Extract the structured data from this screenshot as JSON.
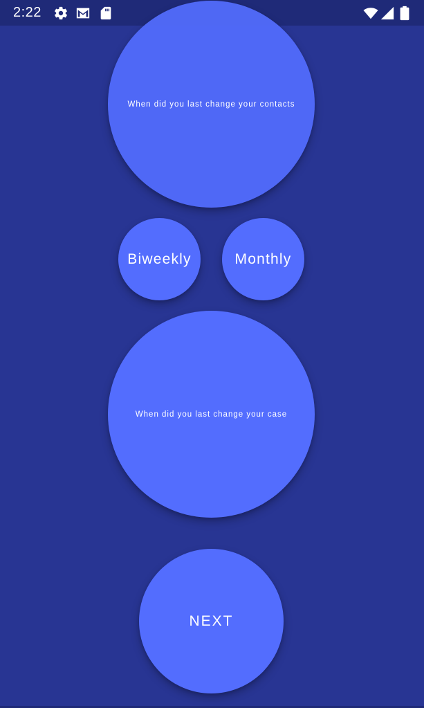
{
  "status_bar": {
    "time": "2:22",
    "left_icons": [
      "settings-icon",
      "gmail-icon",
      "sd-card-icon"
    ],
    "right_icons": [
      "wifi-icon",
      "signal-icon",
      "battery-icon"
    ]
  },
  "questions": [
    {
      "text": "When did you last change your contacts"
    },
    {
      "text": "When did you last change your case"
    }
  ],
  "options": [
    {
      "label": "Biweekly"
    },
    {
      "label": "Monthly"
    }
  ],
  "next_button": {
    "label": "NEXT"
  },
  "colors": {
    "background": "#283593",
    "status_bar": "#1f2a78",
    "circle": "#536dfe",
    "text": "#ffffff"
  }
}
